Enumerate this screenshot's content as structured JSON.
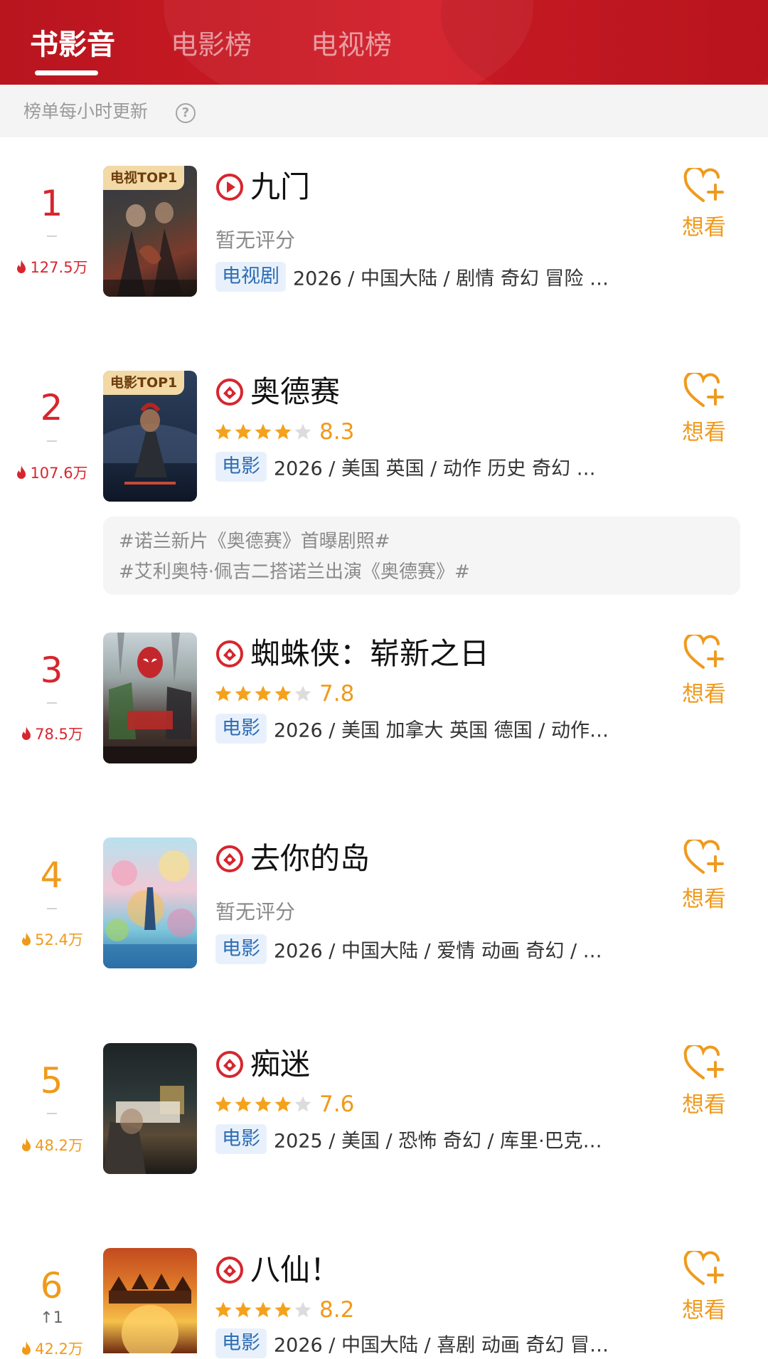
{
  "header": {
    "tabs": [
      {
        "label": "书影音",
        "active": true
      },
      {
        "label": "电影榜",
        "active": false
      },
      {
        "label": "电视榜",
        "active": false
      }
    ]
  },
  "info_bar": {
    "text": "榜单每小时更新",
    "help_icon": "question-circle-icon"
  },
  "colors": {
    "header_red": "#c81b24",
    "rank_red": "#d7262e",
    "rank_orange": "#f09a1a",
    "star_gold": "#f4a21c",
    "tag_bg": "#e8f1fb",
    "tag_text": "#2f6db4"
  },
  "items": [
    {
      "rank": "1",
      "heat": "127.5万",
      "heat_color": "red",
      "move": "",
      "title": "九门",
      "title_icon": "play-circle-icon",
      "badge": "电视TOP1",
      "rating_text": "暂无评分",
      "stars": null,
      "score": "",
      "type": "电视剧",
      "meta": "2026 / 中国大陆 / 剧情 奇幻 冒险 …",
      "want": "想看"
    },
    {
      "rank": "2",
      "heat": "107.6万",
      "heat_color": "red",
      "move": "",
      "title": "奥德赛",
      "title_icon": "film-circle-icon",
      "badge": "电影TOP1",
      "rating_text": "",
      "stars": 4,
      "score": "8.3",
      "type": "电影",
      "meta": "2026 / 美国 英国 / 动作 历史 奇幻 …",
      "want": "想看",
      "topics": [
        "#诺兰新片《奥德赛》首曝剧照#",
        "#艾利奥特·佩吉二搭诺兰出演《奥德赛》#"
      ]
    },
    {
      "rank": "3",
      "heat": "78.5万",
      "heat_color": "red",
      "move": "",
      "title": "蜘蛛侠：崭新之日",
      "title_icon": "film-circle-icon",
      "badge": "",
      "rating_text": "",
      "stars": 4,
      "score": "7.8",
      "type": "电影",
      "meta": "2026 / 美国 加拿大 英国 德国 / 动作…",
      "want": "想看"
    },
    {
      "rank": "4",
      "heat": "52.4万",
      "heat_color": "orange",
      "move": "",
      "title": "去你的岛",
      "title_icon": "film-circle-icon",
      "badge": "",
      "rating_text": "暂无评分",
      "stars": null,
      "score": "",
      "type": "电影",
      "meta": "2026 / 中国大陆 / 爱情 动画 奇幻 / …",
      "want": "想看"
    },
    {
      "rank": "5",
      "heat": "48.2万",
      "heat_color": "orange",
      "move": "",
      "title": "痴迷",
      "title_icon": "film-circle-icon",
      "badge": "",
      "rating_text": "",
      "stars": 4,
      "score": "7.6",
      "type": "电影",
      "meta": "2025 / 美国 / 恐怖 奇幻 / 库里·巴克…",
      "want": "想看"
    },
    {
      "rank": "6",
      "heat": "42.2万",
      "heat_color": "orange",
      "move": "↑1",
      "title": "八仙！",
      "title_icon": "film-circle-icon",
      "badge": "",
      "rating_text": "",
      "stars": 4,
      "score": "8.2",
      "type": "电影",
      "meta": "2026 / 中国大陆 / 喜剧 动画 奇幻 冒…",
      "want": "想看"
    }
  ]
}
